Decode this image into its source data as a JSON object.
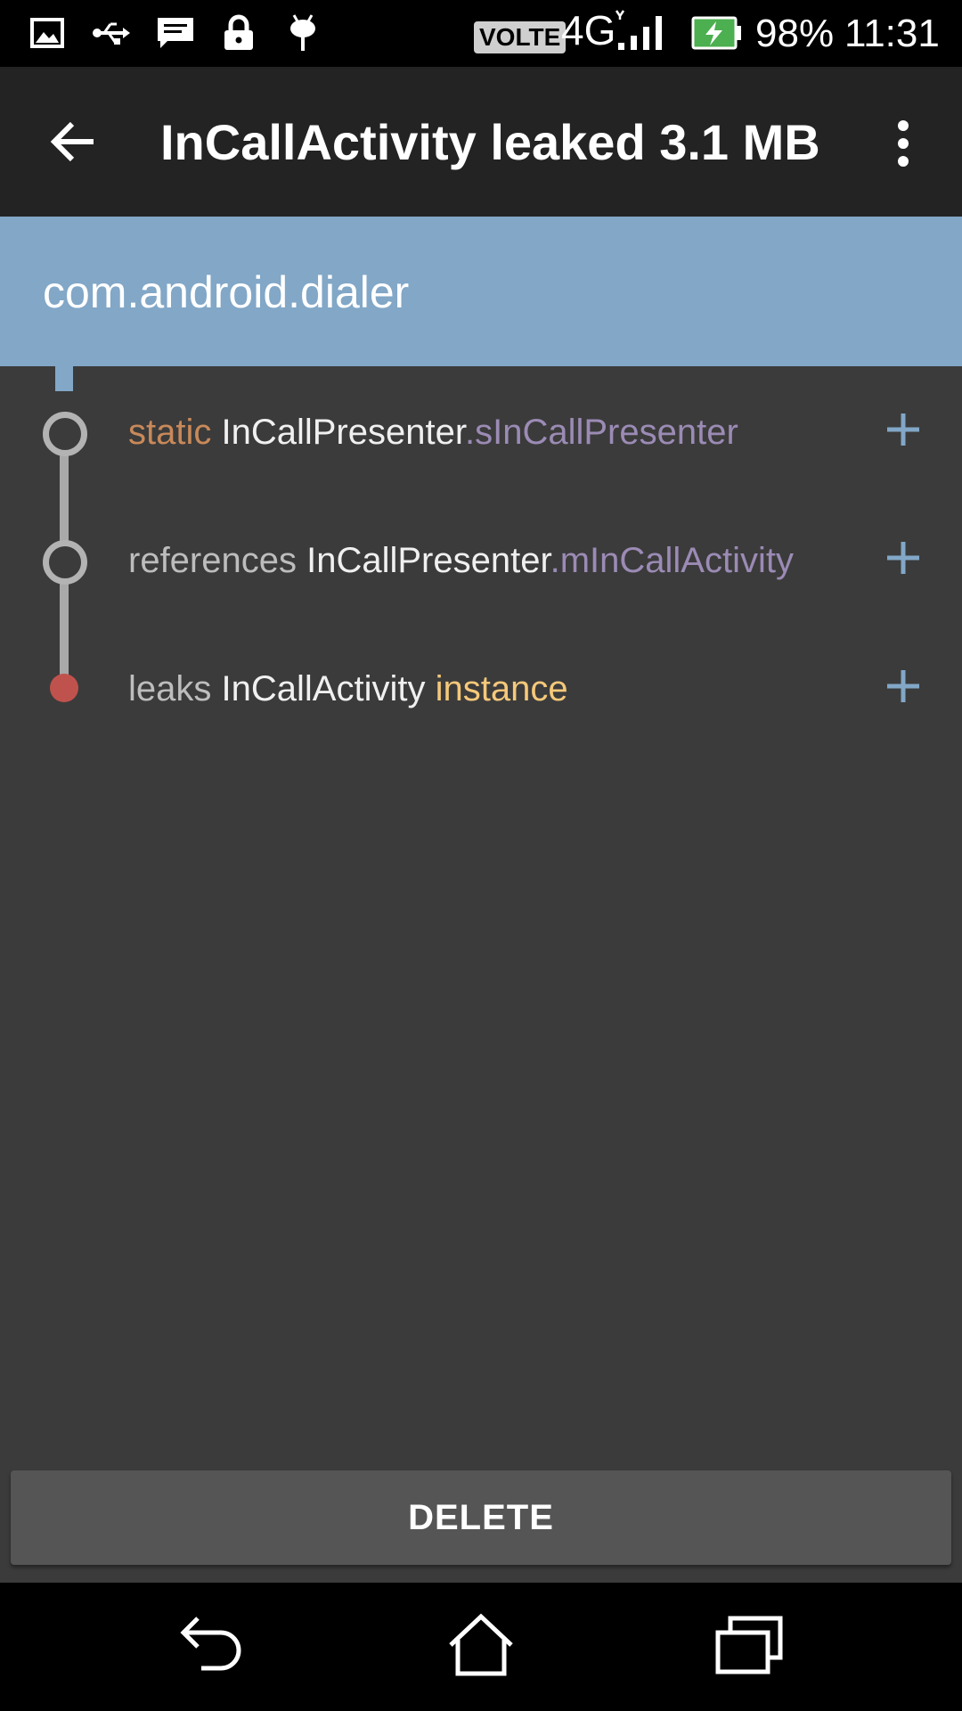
{
  "status_bar": {
    "network_badge": "VOLTE",
    "network_type": "4G",
    "battery": "98%",
    "time": "11:31",
    "icons": [
      "gallery-icon",
      "usb-icon",
      "message-icon",
      "lock-icon",
      "debug-icon",
      "signal-icon",
      "battery-charging-icon"
    ]
  },
  "app_bar": {
    "title": "InCallActivity leaked 3.1 MB",
    "back_icon": "arrow-left-icon",
    "menu_icon": "more-vert-icon"
  },
  "package": {
    "name": "com.android.dialer"
  },
  "trace": [
    {
      "prefix": "static",
      "class_name": "InCallPresenter",
      "separator": ".",
      "member": "sInCallPresenter",
      "node": "ring"
    },
    {
      "prefix": "references",
      "class_name": "InCallPresenter",
      "separator": ".",
      "member": "mInCallActivity",
      "node": "ring"
    },
    {
      "prefix": "leaks",
      "class_name": "InCallActivity",
      "separator": " ",
      "member": "instance",
      "node": "leak-dot"
    }
  ],
  "actions": {
    "delete_label": "DELETE"
  },
  "colors": {
    "accent_blue": "#82a7c7",
    "static_keyword": "#c8895a",
    "field_name": "#9b8bb5",
    "instance_word": "#f5c87a",
    "leak_dot": "#c0524d",
    "background": "#3b3b3b",
    "app_bar": "#232323"
  },
  "nav_bar": {
    "icons": [
      "nav-back-icon",
      "nav-home-icon",
      "nav-recents-icon"
    ]
  }
}
